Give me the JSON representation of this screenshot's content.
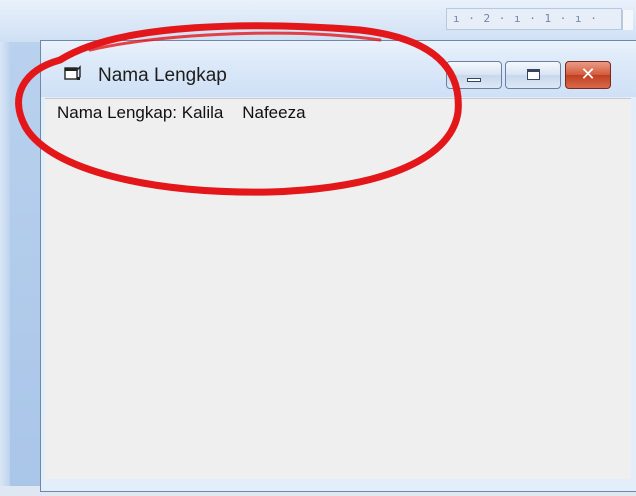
{
  "background_app": {
    "ruler_text": "ı · 2 · ı · 1 · ı ·"
  },
  "window": {
    "title": "Nama Lengkap",
    "icon": "form-icon",
    "controls": {
      "minimize_icon": "minimize-icon",
      "maximize_icon": "maximize-icon",
      "close_icon": "close-icon",
      "close_glyph": "✕"
    }
  },
  "content": {
    "label": "Nama Lengkap: Kalila    Nafeeza"
  },
  "colors": {
    "annotation": "#e3171a",
    "close_button": "#c9482a",
    "title_bar": "#dce9f9",
    "client_area": "#efefef"
  }
}
